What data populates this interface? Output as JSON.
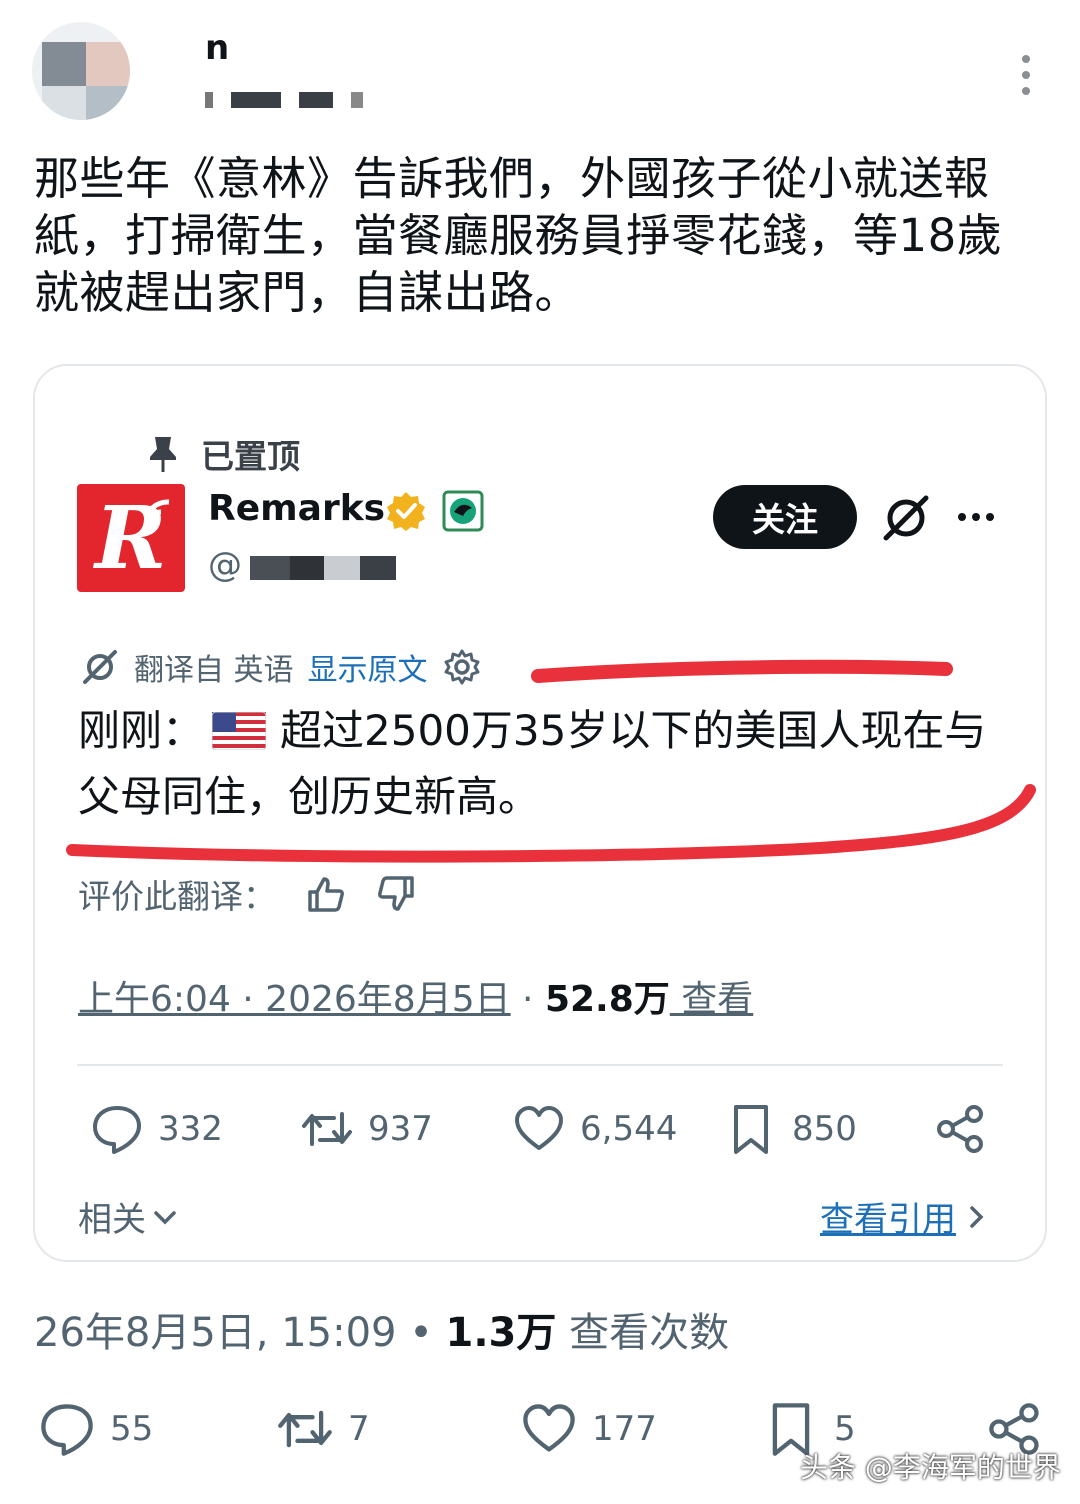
{
  "outer_post": {
    "name_partial": "n",
    "text": "那些年《意林》告訴我們，外國孩子從小就送報紙，打掃衛生，當餐廳服務員掙零花錢，等18歲就被趕出家門，自謀出路。",
    "meta": {
      "datetime": "26年8月5日, 15:09",
      "separator": " • ",
      "views_count": "1.3万",
      "views_label": " 查看次数"
    },
    "actions": {
      "replies": "55",
      "reposts": "7",
      "likes": "177",
      "bookmarks": "5"
    }
  },
  "quoted_post": {
    "pinned_label": "已置顶",
    "account_name": "Remarks",
    "handle_prefix": "@",
    "logo_letter": "R",
    "follow_label": "关注",
    "translate": {
      "label": "翻译自 英语",
      "show_original": "显示原文"
    },
    "text_prefix": "刚刚：",
    "text_body": "超过2500万35岁以下的美国人现在与父母同住，创历史新高。",
    "rate_label": "评价此翻译：",
    "timestamp": {
      "time_date": "上午6:04 · 2026年8月5日",
      "separator": " · ",
      "views_count": "52.8万",
      "views_label": " 查看"
    },
    "actions": {
      "replies": "332",
      "reposts": "937",
      "likes": "6,544",
      "bookmarks": "850"
    },
    "related_label": "相关",
    "view_quotes_label": "查看引用"
  },
  "watermark": "头条 @李海军的世界",
  "colors": {
    "text_primary": "#0f1419",
    "text_secondary": "#536471",
    "link_blue": "#1d6fb8",
    "brand_red": "#e3262e",
    "highlighter_red": "#e8313a",
    "verified_gold": "#f2b21d"
  },
  "icons": [
    "pin-icon",
    "verified-badge-icon",
    "grok-icon",
    "more-icon",
    "translate-icon",
    "settings-icon",
    "thumbs-up-icon",
    "thumbs-down-icon",
    "reply-icon",
    "repost-icon",
    "like-icon",
    "bookmark-icon",
    "share-icon",
    "chevron-down-icon",
    "chevron-right-icon",
    "us-flag-icon"
  ]
}
